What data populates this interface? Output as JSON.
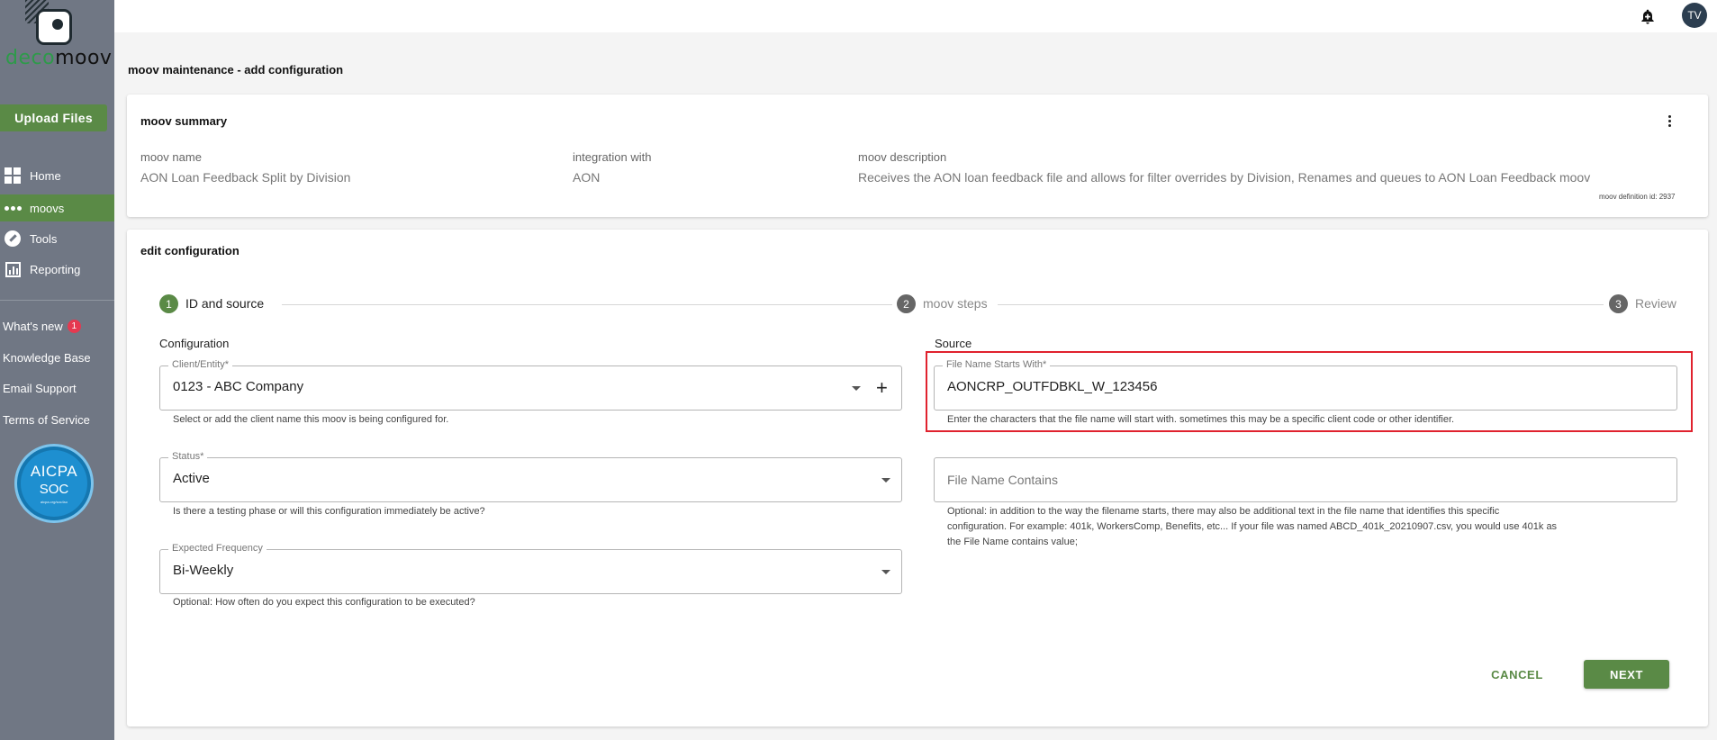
{
  "brand": {
    "logo_text_prefix": "deco",
    "logo_text_suffix": "moov",
    "accent_color": "#5a8a46",
    "sidebar_color": "#707784"
  },
  "sidebar": {
    "upload_label": "Upload Files",
    "nav": [
      {
        "label": "Home",
        "icon": "home-icon"
      },
      {
        "label": "moovs",
        "icon": "moovs-icon"
      },
      {
        "label": "Tools",
        "icon": "tools-icon"
      },
      {
        "label": "Reporting",
        "icon": "reporting-icon"
      }
    ],
    "links": {
      "whats_new": "What's new",
      "whats_new_count": "1",
      "knowledge_base": "Knowledge Base",
      "email_support": "Email Support",
      "terms": "Terms of Service"
    },
    "soc_badge": {
      "line1": "AICPA",
      "line2": "SOC",
      "line3": "aicpa.org/soc4so"
    }
  },
  "topbar": {
    "avatar_initials": "TV",
    "icons": [
      "notification-bell-icon"
    ]
  },
  "page": {
    "title": "moov maintenance - add configuration"
  },
  "summary": {
    "title": "moov summary",
    "moov_name_label": "moov name",
    "moov_name_value": "AON Loan Feedback Split by Division",
    "integration_label": "integration with",
    "integration_value": "AON",
    "description_label": "moov description",
    "description_value": "Receives the AON loan feedback file and allows for filter overrides by Division, Renames and queues to AON Loan Feedback moov",
    "definition_id": "moov definition id: 2937"
  },
  "edit": {
    "title": "edit configuration",
    "steps": [
      {
        "num": "1",
        "label": "ID and source",
        "state": "active"
      },
      {
        "num": "2",
        "label": "moov steps",
        "state": "inactive"
      },
      {
        "num": "3",
        "label": "Review",
        "state": "inactive"
      }
    ],
    "configuration_heading": "Configuration",
    "source_heading": "Source",
    "client": {
      "label": "Client/Entity*",
      "value": "0123 - ABC Company",
      "helper": "Select or add the client name this moov is being configured for."
    },
    "status": {
      "label": "Status*",
      "value": "Active",
      "helper": "Is there a testing phase or will this configuration immediately be active?"
    },
    "frequency": {
      "label": "Expected Frequency",
      "value": "Bi-Weekly",
      "helper": "Optional: How often do you expect this configuration to be executed?"
    },
    "file_starts": {
      "label": "File Name Starts With*",
      "value": "AONCRP_OUTFDBKL_W_123456",
      "helper": "Enter the characters that the file name will start with. sometimes this may be a specific client code or other identifier."
    },
    "file_contains": {
      "placeholder": "File Name Contains",
      "helper_lines": [
        "Optional: in addition to the way the filename starts, there may also be additional text in the file name that identifies this specific",
        "configuration. For example: 401k, WorkersComp, Benefits, etc... If your file was named ABCD_401k_20210907.csv, you would use 401k as",
        "the File Name contains value;"
      ]
    },
    "cancel_label": "CANCEL",
    "next_label": "NEXT"
  }
}
